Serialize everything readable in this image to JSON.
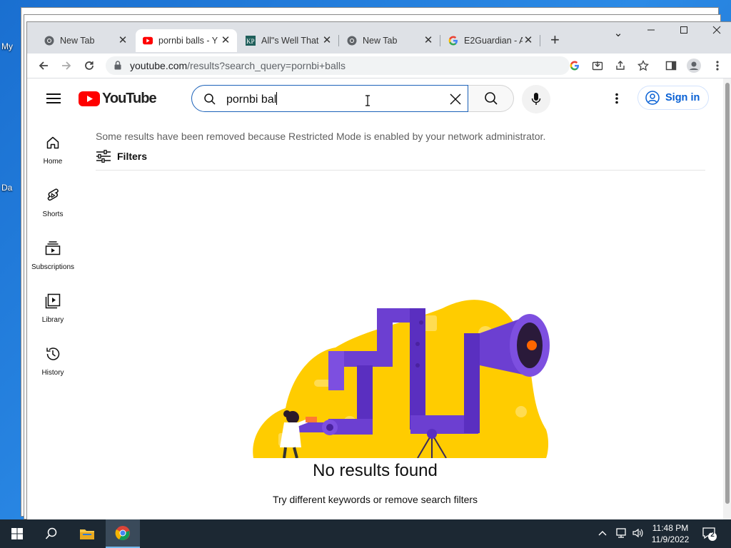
{
  "desktop": {
    "label_my": "My",
    "label_da": "Da"
  },
  "tabs": [
    {
      "title": "New Tab",
      "favicon": "chrome-icon"
    },
    {
      "title": "pornbi balls - Y",
      "favicon": "youtube-icon"
    },
    {
      "title": "All\"s Well That",
      "favicon": "kp-icon"
    },
    {
      "title": "New Tab",
      "favicon": "chrome-icon"
    },
    {
      "title": "E2Guardian - A",
      "favicon": "google-icon"
    }
  ],
  "toolbar": {
    "url_host": "youtube.com",
    "url_path": "/results?search_query=pornbi+balls"
  },
  "youtube": {
    "logo_text": "YouTube",
    "search_value": "pornbi bal",
    "sign_in_label": "Sign in",
    "sidebar": [
      {
        "label": "Home",
        "icon": "home-icon"
      },
      {
        "label": "Shorts",
        "icon": "shorts-icon"
      },
      {
        "label": "Subscriptions",
        "icon": "subscriptions-icon"
      },
      {
        "label": "Library",
        "icon": "library-icon"
      },
      {
        "label": "History",
        "icon": "history-icon"
      }
    ],
    "restricted_notice": "Some results have been removed because Restricted Mode is enabled by your network administrator.",
    "filters_label": "Filters",
    "no_results_title": "No results found",
    "no_results_sub": "Try different keywords or remove search filters"
  },
  "taskbar": {
    "time": "11:48 PM",
    "date": "11/9/2022",
    "notification_count": "2"
  },
  "colors": {
    "youtube_red": "#ff0000",
    "link_blue": "#065fd4",
    "illustration_yellow": "#ffcc00",
    "illustration_purple": "#6c3fd1"
  }
}
